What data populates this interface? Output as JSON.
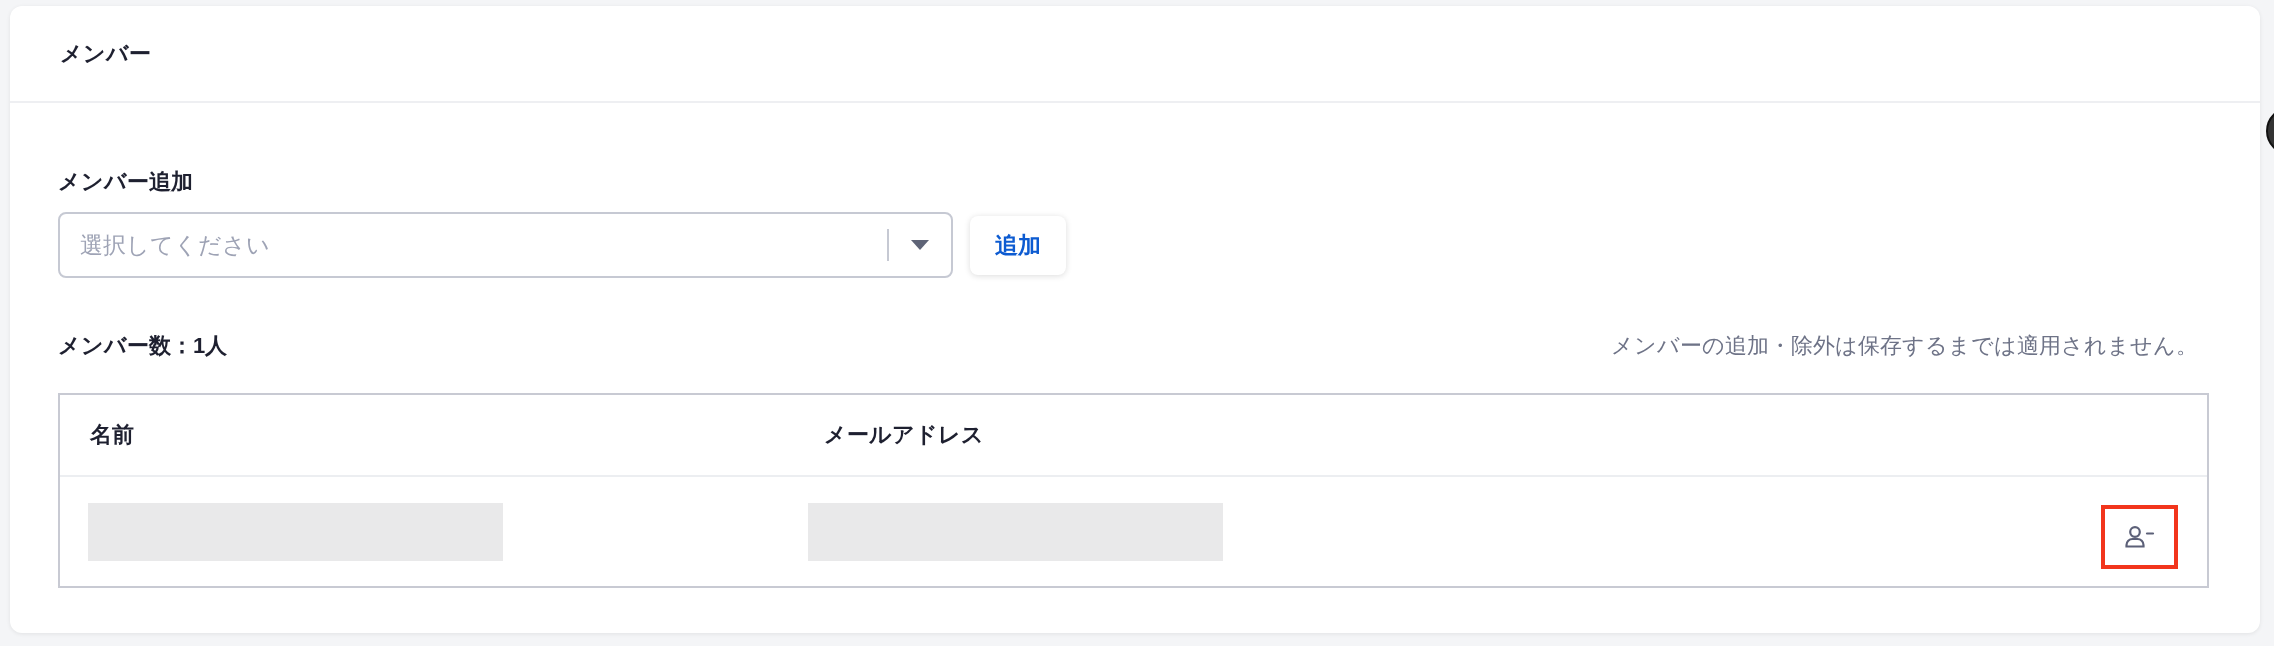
{
  "card": {
    "title": "メンバー"
  },
  "add_member": {
    "label": "メンバー追加",
    "select": {
      "placeholder": "選択してください"
    },
    "button": "追加"
  },
  "member_count": "メンバー数：1人",
  "note": "メンバーの追加・除外は保存するまでは適用されません。",
  "table": {
    "columns": [
      "名前",
      "メールアドレス"
    ],
    "rows": [
      {
        "cells": [
          {
            "kind": "redacted"
          },
          {
            "kind": "redacted"
          }
        ],
        "action": {
          "kind": "remove_member",
          "highlighted": true
        }
      }
    ]
  }
}
